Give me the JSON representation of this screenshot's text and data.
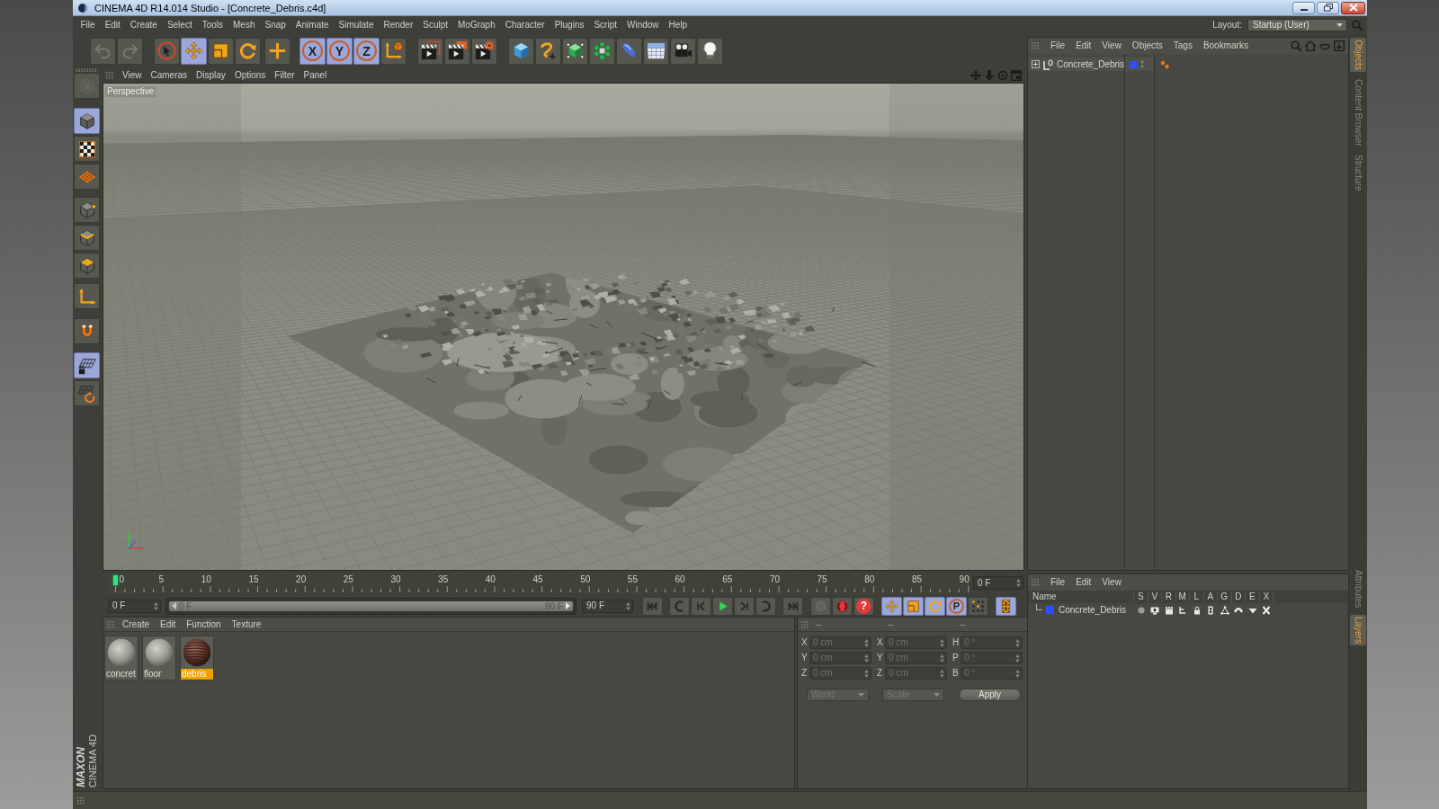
{
  "window": {
    "title": "CINEMA 4D R14.014 Studio - [Concrete_Debris.c4d]"
  },
  "menu_bar": {
    "items": [
      "File",
      "Edit",
      "Create",
      "Select",
      "Tools",
      "Mesh",
      "Snap",
      "Animate",
      "Simulate",
      "Render",
      "Sculpt",
      "MoGraph",
      "Character",
      "Plugins",
      "Script",
      "Window",
      "Help"
    ],
    "layout_label": "Layout:",
    "layout_value": "Startup (User)"
  },
  "toolbar": {
    "groups": [
      [
        {
          "kind": "undo",
          "selected": false,
          "disabled": true
        },
        {
          "kind": "redo",
          "selected": false,
          "disabled": true
        }
      ],
      [
        {
          "kind": "select",
          "selected": false,
          "disabled": false
        },
        {
          "kind": "move",
          "selected": true,
          "disabled": false
        },
        {
          "kind": "scale",
          "selected": false,
          "disabled": false
        },
        {
          "kind": "rotate",
          "selected": false,
          "disabled": false
        }
      ],
      [
        {
          "kind": "recent",
          "selected": false,
          "disabled": false
        }
      ],
      [
        {
          "kind": "axis",
          "label": "X",
          "selected": true,
          "disabled": false
        },
        {
          "kind": "axis",
          "label": "Y",
          "selected": true,
          "disabled": false
        },
        {
          "kind": "axis",
          "label": "Z",
          "selected": true,
          "disabled": false
        },
        {
          "kind": "coordinates",
          "selected": false,
          "disabled": false
        }
      ],
      [
        {
          "kind": "renderview",
          "selected": false,
          "disabled": false
        },
        {
          "kind": "renderpicture",
          "selected": false,
          "disabled": false
        },
        {
          "kind": "rendersettings",
          "selected": false,
          "disabled": false
        }
      ],
      [
        {
          "kind": "cube",
          "selected": false,
          "disabled": false
        },
        {
          "kind": "spline",
          "selected": false,
          "disabled": false
        },
        {
          "kind": "nurbs",
          "selected": false,
          "disabled": false
        },
        {
          "kind": "cloner",
          "selected": false,
          "disabled": false
        },
        {
          "kind": "deformer",
          "selected": false,
          "disabled": false
        },
        {
          "kind": "floor",
          "selected": false,
          "disabled": false
        },
        {
          "kind": "camera",
          "selected": false,
          "disabled": false
        },
        {
          "kind": "light",
          "selected": false,
          "disabled": false
        }
      ]
    ]
  },
  "left_toolbar": {
    "groups": [
      [
        {
          "kind": "model",
          "selected": false,
          "disabled": true
        }
      ],
      [
        {
          "kind": "object",
          "selected": true,
          "disabled": false
        },
        {
          "kind": "texture",
          "selected": false,
          "disabled": false
        },
        {
          "kind": "axisplane",
          "selected": false,
          "disabled": false
        }
      ],
      [
        {
          "kind": "points",
          "selected": false,
          "disabled": false
        },
        {
          "kind": "edges",
          "selected": false,
          "disabled": false
        },
        {
          "kind": "polygons",
          "selected": false,
          "disabled": false
        }
      ],
      [
        {
          "kind": "modelaxis",
          "selected": false,
          "disabled": false
        }
      ],
      [
        {
          "kind": "magnet",
          "selected": false,
          "disabled": false
        }
      ],
      [
        {
          "kind": "workplane",
          "selected": true,
          "disabled": false
        },
        {
          "kind": "snap",
          "selected": false,
          "disabled": false
        }
      ]
    ]
  },
  "viewport": {
    "menu": [
      "View",
      "Cameras",
      "Display",
      "Options",
      "Filter",
      "Panel"
    ],
    "camera": "Perspective"
  },
  "timeline": {
    "frames": [
      "0",
      "5",
      "10",
      "15",
      "20",
      "25",
      "30",
      "35",
      "40",
      "45",
      "50",
      "55",
      "60",
      "65",
      "70",
      "75",
      "80",
      "85",
      "90"
    ],
    "level": 0,
    "current": "0 F"
  },
  "playback": {
    "start": "0 F",
    "range": {
      "start": "0 F",
      "end": "90 F",
      "level": 1
    },
    "end": "90 F",
    "buttons": [
      [
        {
          "kind": "first",
          "selected": false,
          "disabled": false
        }
      ],
      [
        {
          "kind": "prevkey",
          "selected": false,
          "disabled": false
        },
        {
          "kind": "stepback",
          "selected": false,
          "disabled": false
        },
        {
          "kind": "play",
          "selected": false,
          "disabled": false
        },
        {
          "kind": "stepfwd",
          "selected": false,
          "disabled": false
        },
        {
          "kind": "nextkey",
          "selected": false,
          "disabled": false
        }
      ],
      [
        {
          "kind": "last",
          "selected": false,
          "disabled": false
        }
      ],
      [
        {
          "kind": "record",
          "selected": false,
          "disabled": true
        },
        {
          "kind": "autokey",
          "selected": false,
          "disabled": false
        },
        {
          "kind": "help",
          "label": "?",
          "selected": false,
          "disabled": false
        }
      ],
      [
        {
          "kind": "move",
          "selected": true,
          "disabled": false
        },
        {
          "kind": "scale",
          "selected": true,
          "disabled": false
        },
        {
          "kind": "rotate",
          "selected": true,
          "disabled": false
        },
        {
          "kind": "param",
          "label": "P",
          "selected": true,
          "disabled": false
        }
      ],
      [
        {
          "kind": "dots",
          "selected": false,
          "disabled": false
        }
      ],
      [
        {
          "kind": "timeline",
          "selected": true,
          "disabled": false
        }
      ]
    ]
  },
  "material_manager": {
    "menu": [
      "Create",
      "Edit",
      "Function",
      "Texture"
    ],
    "materials": [
      {
        "name": "concret",
        "kind": "stone",
        "selected": false
      },
      {
        "name": "floor",
        "kind": "stone",
        "selected": false
      },
      {
        "name": "debris",
        "kind": "rust",
        "selected": true
      }
    ]
  },
  "coordinates": {
    "disabled": true,
    "headers": [
      "--",
      "--",
      "--"
    ],
    "rows": [
      {
        "fields": [
          {
            "axis": "X",
            "value": "0 cm"
          },
          {
            "axis": "X",
            "value": "0 cm"
          },
          {
            "axis": "H",
            "value": "0 °"
          }
        ]
      },
      {
        "fields": [
          {
            "axis": "Y",
            "value": "0 cm"
          },
          {
            "axis": "Y",
            "value": "0 cm"
          },
          {
            "axis": "P",
            "value": "0 °"
          }
        ]
      },
      {
        "fields": [
          {
            "axis": "Z",
            "value": "0 cm"
          },
          {
            "axis": "Z",
            "value": "0 cm"
          },
          {
            "axis": "B",
            "value": "0 °"
          }
        ]
      }
    ],
    "mode": "World",
    "transform": "Scale",
    "apply": "Apply"
  },
  "object_manager": {
    "menu": [
      "File",
      "Edit",
      "View",
      "Objects",
      "Tags",
      "Bookmarks"
    ],
    "objects": [
      {
        "name": "Concrete_Debris",
        "expanded": false,
        "color": "#2f4dff"
      }
    ]
  },
  "layer_manager": {
    "menu": [
      "File",
      "Edit",
      "View"
    ],
    "columns": [
      "Name",
      "S",
      "V",
      "R",
      "M",
      "L",
      "A",
      "G",
      "D",
      "E",
      "X"
    ],
    "layers": [
      {
        "name": "Concrete_Debris",
        "color": "#2f4dff"
      }
    ]
  },
  "side_tabs": {
    "top": [
      {
        "label": "Objects",
        "selected": true
      },
      {
        "label": "Content Browser",
        "selected": false
      },
      {
        "label": "Structure",
        "selected": false
      }
    ],
    "bottom": [
      {
        "label": "Attributes",
        "selected": false
      },
      {
        "label": "Layers",
        "selected": true
      }
    ]
  },
  "logo": {
    "brand": "MAXON",
    "product": "CINEMA 4D"
  }
}
